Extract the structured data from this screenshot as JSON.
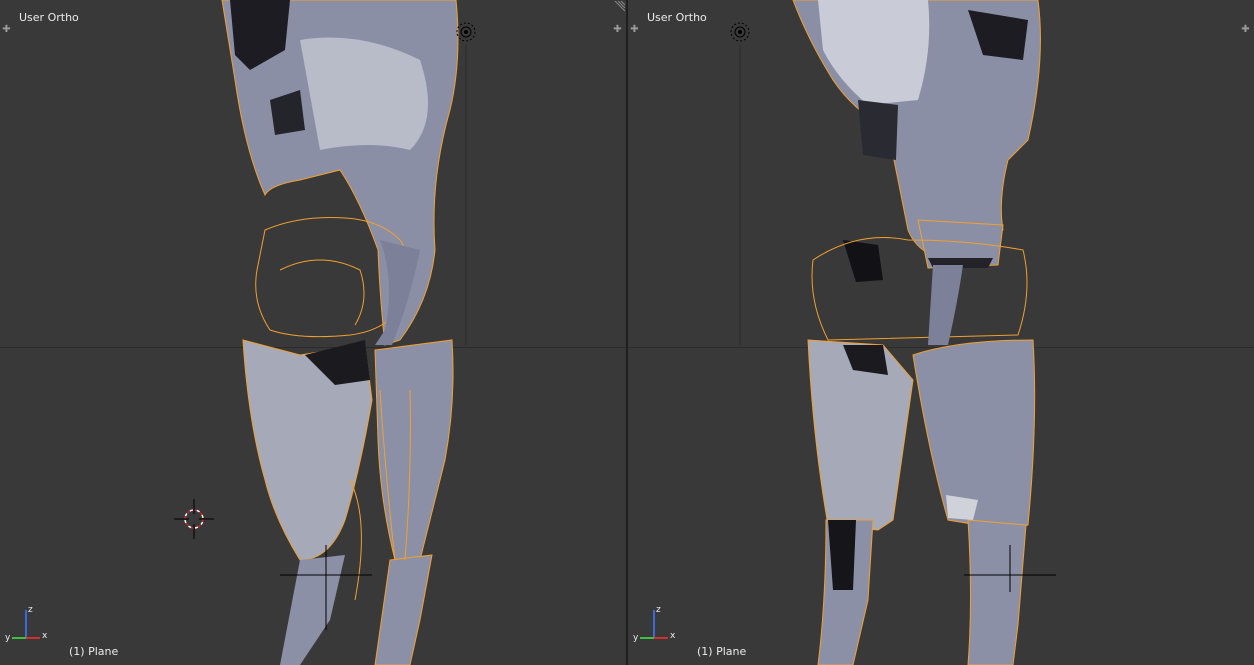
{
  "viewports": [
    {
      "id": "left",
      "view_label": "User Ortho",
      "object_label": "(1) Plane",
      "axes": {
        "x": "x",
        "y": "y",
        "z": "z"
      },
      "icons": [
        "view-plus-icon-left",
        "view-plus-icon-right",
        "area-split-icon",
        "3d-cursor-icon",
        "lamp-icon",
        "orientation-axes-icon"
      ]
    },
    {
      "id": "right",
      "view_label": "User Ortho",
      "object_label": "(1) Plane",
      "axes": {
        "x": "x",
        "y": "y",
        "z": "z"
      },
      "icons": [
        "view-plus-icon-left",
        "view-plus-icon-right",
        "lamp-icon",
        "orientation-axes-icon"
      ]
    }
  ],
  "colors": {
    "viewport_bg": "#393939",
    "mesh": "#8b8fa6",
    "mesh_light": "#c9cbd6",
    "mesh_dark": "#1a1a1f",
    "selection_wire": "#f0a030",
    "text": "#ececec",
    "axis_x": "#d03030",
    "axis_y": "#40c040",
    "axis_z": "#3a6bd8"
  }
}
